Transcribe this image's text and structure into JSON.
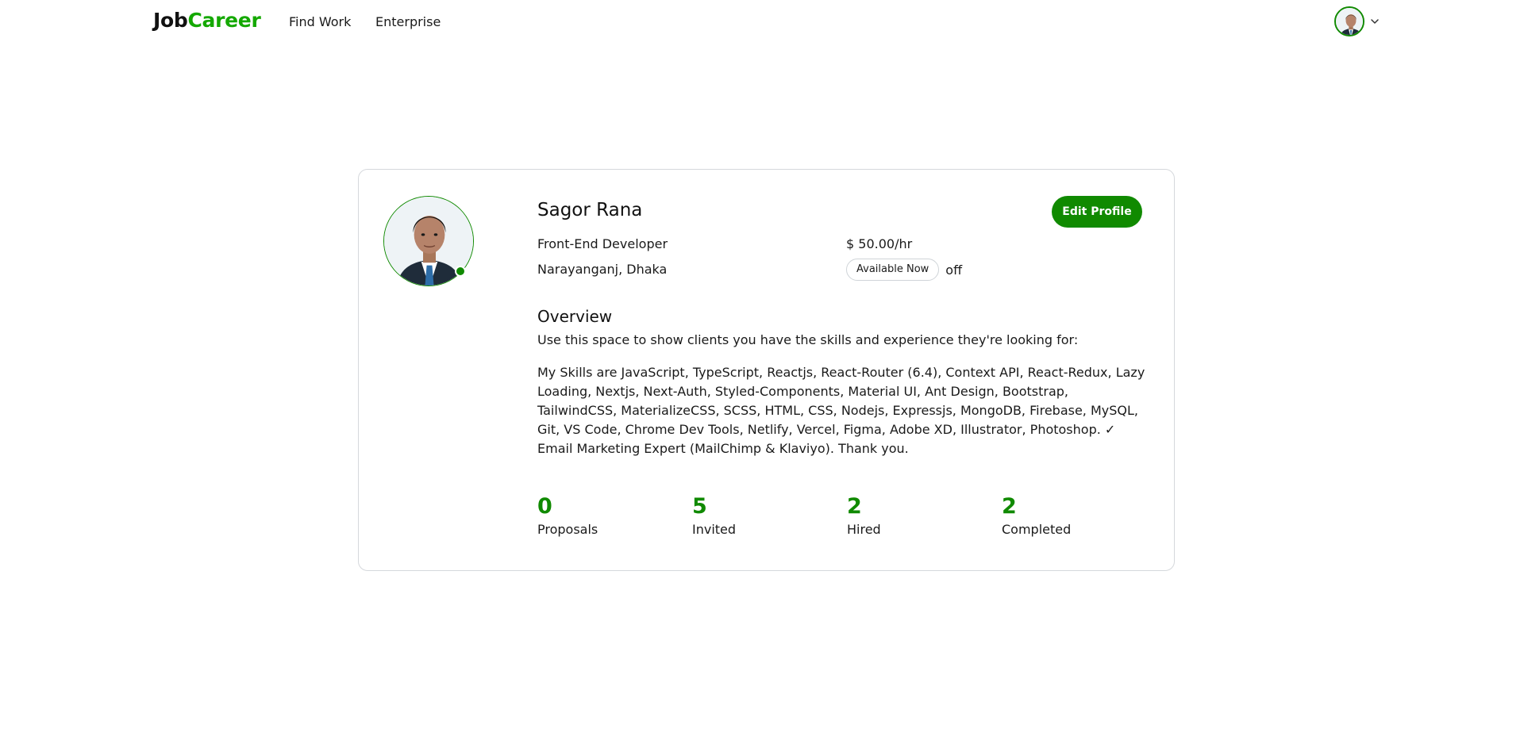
{
  "header": {
    "logo_part1": "Job",
    "logo_part2": "Career",
    "nav": [
      {
        "label": "Find Work"
      },
      {
        "label": "Enterprise"
      }
    ],
    "user_menu_icon": "chevron-down-icon"
  },
  "profile": {
    "name": "Sagor Rana",
    "edit_label": "Edit Profile",
    "title": "Front-End Developer",
    "location": "Narayanganj, Dhaka",
    "rate": "$ 50.00/hr",
    "availability_label": "Available Now",
    "availability_state": "off",
    "overview_heading": "Overview",
    "overview_intro": "Use this space to show clients you have the skills and experience they're looking for:",
    "overview_body": "My Skills are JavaScript, TypeScript, Reactjs, React-Router (6.4), Context API, React-Redux, Lazy Loading, Nextjs, Next-Auth, Styled-Components, Material UI, Ant Design, Bootstrap, TailwindCSS, MaterializeCSS, SCSS, HTML, CSS, Nodejs, Expressjs, MongoDB, Firebase, MySQL, Git, VS Code, Chrome Dev Tools, Netlify, Vercel, Figma, Adobe XD, Illustrator, Photoshop. ✓ Email Marketing Expert (MailChimp & Klaviyo). Thank you.",
    "stats": [
      {
        "value": "0",
        "label": "Proposals"
      },
      {
        "value": "5",
        "label": "Invited"
      },
      {
        "value": "2",
        "label": "Hired"
      },
      {
        "value": "2",
        "label": "Completed"
      }
    ]
  },
  "colors": {
    "brand": "#14a800",
    "accent": "#108a00",
    "text": "#1a1a1a",
    "border": "#d5d8dc"
  }
}
